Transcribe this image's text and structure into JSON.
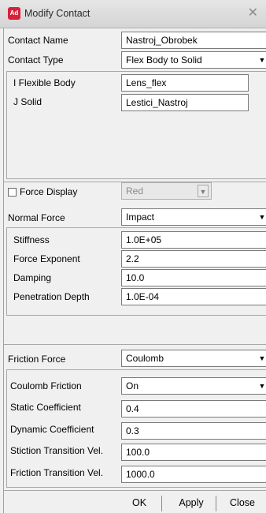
{
  "window": {
    "title": "Modify Contact",
    "app_icon_text": "Ad"
  },
  "contact": {
    "name_label": "Contact Name",
    "name_value": "Nastroj_Obrobek",
    "type_label": "Contact Type",
    "type_value": "Flex Body to Solid",
    "i_body_label": "I Flexible Body",
    "i_body_value": "Lens_flex",
    "j_solid_label": "J Solid",
    "j_solid_value": "Lestici_Nastroj"
  },
  "force_display": {
    "label": "Force Display",
    "checked": false,
    "value": "Red"
  },
  "normal_force": {
    "label": "Normal Force",
    "value": "Impact",
    "stiffness_label": "Stiffness",
    "stiffness_value": "1.0E+05",
    "exponent_label": "Force Exponent",
    "exponent_value": "2.2",
    "damping_label": "Damping",
    "damping_value": "10.0",
    "penetration_label": "Penetration Depth",
    "penetration_value": "1.0E-04"
  },
  "friction_force": {
    "label": "Friction Force",
    "value": "Coulomb",
    "coulomb_label": "Coulomb Friction",
    "coulomb_value": "On",
    "static_label": "Static Coefficient",
    "static_value": "0.4",
    "dynamic_label": "Dynamic Coefficient",
    "dynamic_value": "0.3",
    "stiction_label": "Stiction Transition Vel.",
    "stiction_value": "100.0",
    "friction_tv_label": "Friction Transition Vel.",
    "friction_tv_value": "1000.0"
  },
  "buttons": {
    "ok": "OK",
    "apply": "Apply",
    "close": "Close"
  },
  "icons": {
    "close": "close-icon",
    "dropdown": "chevron-down-icon"
  }
}
